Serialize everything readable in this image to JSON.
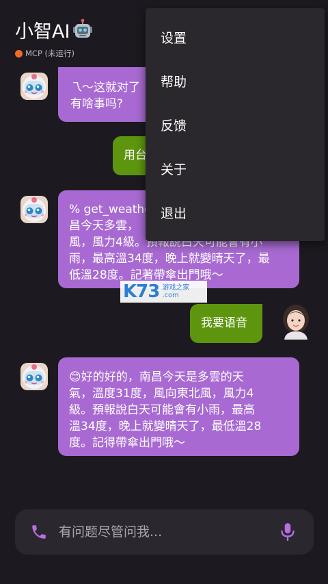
{
  "header": {
    "title": "小智AI",
    "robot_icon": "robot-face-icon",
    "mcp_status": "MCP (未运行)",
    "mcp_status_color": "#f26a2a"
  },
  "messages": [
    {
      "role": "ai",
      "text": "乁～这就对了有啥事吗?",
      "line1": "乁～这就对了",
      "line2": "有啥事吗?"
    },
    {
      "role": "user",
      "text": "用台"
    },
    {
      "role": "ai",
      "line1": "% get_weathe",
      "line2": "昌今天多雲，",
      "line3": "風，風力4級。預報說白天可能會有小",
      "line4": "雨，最高溫34度，晚上就變晴天了，最",
      "line5": "低溫28度。記著帶傘出門哦～"
    },
    {
      "role": "user",
      "text": "我要语音"
    },
    {
      "role": "ai",
      "line1": "😊好的好的，南昌今天是多雲的天",
      "line2": "氣，溫度31度，風向東北風，風力4",
      "line3": "級。預報說白天可能會有小雨，最高",
      "line4": "溫34度，晚上就變晴天了，最低溫28",
      "line5": "度。記得帶傘出門哦～"
    }
  ],
  "input": {
    "placeholder": "有问题尽管问我...",
    "value": ""
  },
  "menu": {
    "items": [
      {
        "label": "设置"
      },
      {
        "label": "帮助"
      },
      {
        "label": "反馈"
      },
      {
        "label": "关于"
      },
      {
        "label": "退出"
      }
    ]
  },
  "watermark": {
    "logo": "K73",
    "line1": "游戏之家",
    "line2": ".com"
  },
  "colors": {
    "background": "#1c1a20",
    "ai_bubble": "#a86ad2",
    "user_bubble": "#5e950e",
    "accent_icon": "#b66fe0"
  }
}
